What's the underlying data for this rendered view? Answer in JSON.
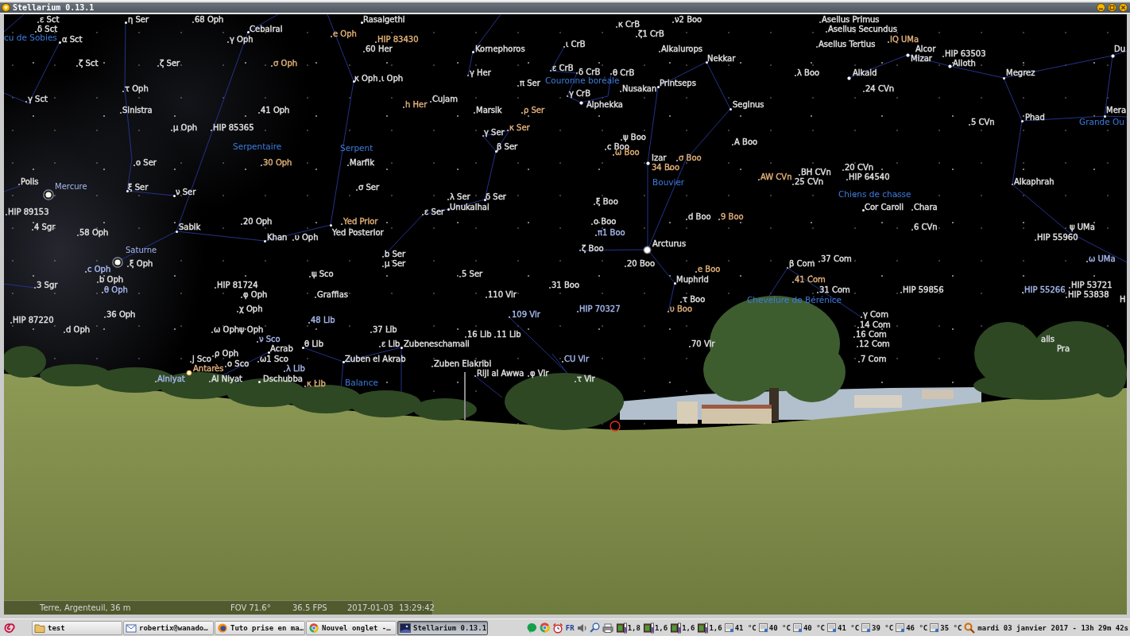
{
  "window": {
    "title": "Stellarium 0.13.1"
  },
  "sky": {
    "constellations": [
      "cu de Sobies",
      "Couronne boréale",
      "Grande Ou",
      "Serpentaire",
      "Serpent",
      "Bouvier",
      "Chiens de chasse",
      "Chevelure de Bérénice",
      "Balance"
    ],
    "planets": [
      "Mercure",
      "Saturne"
    ],
    "stars": [
      {
        "label": "ε Sct",
        "color": "#e0e0e0"
      },
      {
        "label": "η Ser",
        "color": "#e0e0e0"
      },
      {
        "label": "68 Oph",
        "color": "#e0e0e0"
      },
      {
        "label": "Rasalgethi",
        "color": "#e0e0e0"
      },
      {
        "label": "ν2 Boo",
        "color": "#e0e0e0"
      },
      {
        "label": "Asellus Primus",
        "color": "#e0e0e0"
      },
      {
        "label": "κ CrB",
        "color": "#e0e0e0"
      },
      {
        "label": "δ Sct",
        "color": "#e0e0e0"
      },
      {
        "label": "Cebalrai",
        "color": "#e0e0e0"
      },
      {
        "label": "Asellus Secundus",
        "color": "#e0e0e0"
      },
      {
        "label": "e Oph",
        "color": "#e3b178"
      },
      {
        "label": "ζ1 CrB",
        "color": "#e0e0e0"
      },
      {
        "label": "α Sct",
        "color": "#e0e0e0"
      },
      {
        "label": "γ Oph",
        "color": "#e0e0e0"
      },
      {
        "label": "HIP 83430",
        "color": "#e3b178"
      },
      {
        "label": "IQ UMa",
        "color": "#e3b178"
      },
      {
        "label": "ι CrB",
        "color": "#e0e0e0"
      },
      {
        "label": "Asellus Tertius",
        "color": "#e0e0e0"
      },
      {
        "label": "60 Her",
        "color": "#e0e0e0"
      },
      {
        "label": "Kornephoros",
        "color": "#e0e0e0"
      },
      {
        "label": "Alkalurops",
        "color": "#e0e0e0"
      },
      {
        "label": "Alcor",
        "color": "#e0e0e0"
      },
      {
        "label": "Du",
        "color": "#e0e0e0"
      },
      {
        "label": "HIP 63503",
        "color": "#e0e0e0"
      },
      {
        "label": "Nekkar",
        "color": "#e0e0e0"
      },
      {
        "label": "Mizar",
        "color": "#e0e0e0"
      },
      {
        "label": "ζ Sct",
        "color": "#e0e0e0"
      },
      {
        "label": "ζ Ser",
        "color": "#e0e0e0"
      },
      {
        "label": "σ Oph",
        "color": "#e3b178"
      },
      {
        "label": "Alioth",
        "color": "#e0e0e0"
      },
      {
        "label": "ε CrB",
        "color": "#e0e0e0"
      },
      {
        "label": "γ Her",
        "color": "#e0e0e0"
      },
      {
        "label": "δ CrB",
        "color": "#e0e0e0"
      },
      {
        "label": "θ CrB",
        "color": "#e0e0e0"
      },
      {
        "label": "λ Boo",
        "color": "#e0e0e0"
      },
      {
        "label": "Alkaid",
        "color": "#e0e0e0"
      },
      {
        "label": "Megrez",
        "color": "#e0e0e0"
      },
      {
        "label": "κ Oph",
        "color": "#e0e0e0"
      },
      {
        "label": "ι Oph",
        "color": "#e0e0e0"
      },
      {
        "label": "π Ser",
        "color": "#e0e0e0"
      },
      {
        "label": "Printseps",
        "color": "#e0e0e0"
      },
      {
        "label": "τ Oph",
        "color": "#e0e0e0"
      },
      {
        "label": "Nusakan",
        "color": "#e0e0e0"
      },
      {
        "label": "24 CVn",
        "color": "#e0e0e0"
      },
      {
        "label": "γ CrB",
        "color": "#e0e0e0"
      },
      {
        "label": "γ Sct",
        "color": "#e0e0e0"
      },
      {
        "label": "Cujam",
        "color": "#e0e0e0"
      },
      {
        "label": "h Her",
        "color": "#e3b178"
      },
      {
        "label": "Alphekka",
        "color": "#e0e0e0"
      },
      {
        "label": "Seginus",
        "color": "#e0e0e0"
      },
      {
        "label": "Sinistra",
        "color": "#e0e0e0"
      },
      {
        "label": "41 Oph",
        "color": "#e0e0e0"
      },
      {
        "label": "Marsik",
        "color": "#e0e0e0"
      },
      {
        "label": "ρ Ser",
        "color": "#e3b178"
      },
      {
        "label": "Mera",
        "color": "#e0e0e0"
      },
      {
        "label": "Phad",
        "color": "#e0e0e0"
      },
      {
        "label": "5 CVn",
        "color": "#e0e0e0"
      },
      {
        "label": "μ Oph",
        "color": "#e0e0e0"
      },
      {
        "label": "HIP 85365",
        "color": "#e0e0e0"
      },
      {
        "label": "κ Ser",
        "color": "#e3b178"
      },
      {
        "label": "γ Ser",
        "color": "#e0e0e0"
      },
      {
        "label": "ψ Boo",
        "color": "#e0e0e0"
      },
      {
        "label": "A Boo",
        "color": "#e0e0e0"
      },
      {
        "label": "β Ser",
        "color": "#e0e0e0"
      },
      {
        "label": "c Boo",
        "color": "#e0e0e0"
      },
      {
        "label": "ω Boo",
        "color": "#e3b178"
      },
      {
        "label": "Izar",
        "color": "#e0e0e0"
      },
      {
        "label": "σ Boo",
        "color": "#e3b178"
      },
      {
        "label": "ο Ser",
        "color": "#e0e0e0"
      },
      {
        "label": "30 Oph",
        "color": "#e3b178"
      },
      {
        "label": "Marfik",
        "color": "#e0e0e0"
      },
      {
        "label": "34 Boo",
        "color": "#e3b178"
      },
      {
        "label": "20 CVn",
        "color": "#e0e0e0"
      },
      {
        "label": "BH CVn",
        "color": "#e0e0e0"
      },
      {
        "label": "AW CVn",
        "color": "#e3b178"
      },
      {
        "label": "HIP 64540",
        "color": "#e0e0e0"
      },
      {
        "label": "Polis",
        "color": "#e0e0e0"
      },
      {
        "label": "25 CVn",
        "color": "#e0e0e0"
      },
      {
        "label": "Alkaphrah",
        "color": "#e0e0e0"
      },
      {
        "label": "ξ Ser",
        "color": "#e0e0e0"
      },
      {
        "label": "σ Ser",
        "color": "#e0e0e0"
      },
      {
        "label": "ν Ser",
        "color": "#e0e0e0"
      },
      {
        "label": "λ Ser",
        "color": "#e0e0e0"
      },
      {
        "label": "δ Ser",
        "color": "#e0e0e0"
      },
      {
        "label": "ξ Boo",
        "color": "#e0e0e0"
      },
      {
        "label": "Unukalhai",
        "color": "#e0e0e0"
      },
      {
        "label": "Cor Caroli",
        "color": "#e0e0e0"
      },
      {
        "label": "Chara",
        "color": "#e0e0e0"
      },
      {
        "label": "HIP 89153",
        "color": "#e0e0e0"
      },
      {
        "label": "ε Ser",
        "color": "#e0e0e0"
      },
      {
        "label": "d Boo",
        "color": "#e0e0e0"
      },
      {
        "label": "9 Boo",
        "color": "#e3b178"
      },
      {
        "label": "20 Oph",
        "color": "#e0e0e0"
      },
      {
        "label": "Yed Prior",
        "color": "#e3b178"
      },
      {
        "label": "ο Boo",
        "color": "#e0e0e0"
      },
      {
        "label": "4 Sgr",
        "color": "#e0e0e0"
      },
      {
        "label": "Sabik",
        "color": "#e0e0e0"
      },
      {
        "label": "6 CVn",
        "color": "#e0e0e0"
      },
      {
        "label": "ψ UMa",
        "color": "#e0e0e0"
      },
      {
        "label": "58 Oph",
        "color": "#e0e0e0"
      },
      {
        "label": "Yed Posterior",
        "color": "#e0e0e0"
      },
      {
        "label": "π1 Boo",
        "color": "#a6b8ee"
      },
      {
        "label": "Khan",
        "color": "#e0e0e0"
      },
      {
        "label": "υ Oph",
        "color": "#e0e0e0"
      },
      {
        "label": "HIP 55960",
        "color": "#e0e0e0"
      },
      {
        "label": "Arcturus",
        "color": "#e0e0e0"
      },
      {
        "label": "ζ Boo",
        "color": "#e0e0e0"
      },
      {
        "label": "b Ser",
        "color": "#e0e0e0"
      },
      {
        "label": "37 Com",
        "color": "#e0e0e0"
      },
      {
        "label": "ω UMa",
        "color": "#a6b8ee"
      },
      {
        "label": "ξ Oph",
        "color": "#e0e0e0"
      },
      {
        "label": "μ Ser",
        "color": "#e0e0e0"
      },
      {
        "label": "20 Boo",
        "color": "#e0e0e0"
      },
      {
        "label": "β Com",
        "color": "#e0e0e0"
      },
      {
        "label": "c Oph",
        "color": "#a6b8ee"
      },
      {
        "label": "e Boo",
        "color": "#e3b178"
      },
      {
        "label": "ψ Sco",
        "color": "#e0e0e0"
      },
      {
        "label": "5 Ser",
        "color": "#e0e0e0"
      },
      {
        "label": "b Oph",
        "color": "#e0e0e0"
      },
      {
        "label": "Muphrid",
        "color": "#e0e0e0"
      },
      {
        "label": "41 Com",
        "color": "#e3b178"
      },
      {
        "label": "3 Sgr",
        "color": "#e0e0e0"
      },
      {
        "label": "HIP 81724",
        "color": "#e0e0e0"
      },
      {
        "label": "31 Boo",
        "color": "#e0e0e0"
      },
      {
        "label": "HIP 53721",
        "color": "#e0e0e0"
      },
      {
        "label": "θ Oph",
        "color": "#a6b8ee"
      },
      {
        "label": "31 Com",
        "color": "#e0e0e0"
      },
      {
        "label": "HIP 59856",
        "color": "#e0e0e0"
      },
      {
        "label": "HIP 55266",
        "color": "#a6b8ee"
      },
      {
        "label": "φ Oph",
        "color": "#e0e0e0"
      },
      {
        "label": "Graffias",
        "color": "#e0e0e0"
      },
      {
        "label": "110 Vir",
        "color": "#e0e0e0"
      },
      {
        "label": "HIP 53838",
        "color": "#e0e0e0"
      },
      {
        "label": "τ Boo",
        "color": "#e0e0e0"
      },
      {
        "label": "H",
        "color": "#e0e0e0"
      },
      {
        "label": "χ Oph",
        "color": "#e0e0e0"
      },
      {
        "label": "HIP 70327",
        "color": "#a6b8ee"
      },
      {
        "label": "υ Boo",
        "color": "#e3b178"
      },
      {
        "label": "36 Oph",
        "color": "#e0e0e0"
      },
      {
        "label": "109 Vir",
        "color": "#a6b8ee"
      },
      {
        "label": "γ Com",
        "color": "#e0e0e0"
      },
      {
        "label": "HIP 87220",
        "color": "#e0e0e0"
      },
      {
        "label": "48 Lib",
        "color": "#a6b8ee"
      },
      {
        "label": "14 Com",
        "color": "#e0e0e0"
      },
      {
        "label": "d Oph",
        "color": "#e0e0e0"
      },
      {
        "label": "ω Oph",
        "color": "#e0e0e0"
      },
      {
        "label": "ψ Oph",
        "color": "#e0e0e0"
      },
      {
        "label": "37 Lib",
        "color": "#e0e0e0"
      },
      {
        "label": "16 Lib",
        "color": "#e0e0e0"
      },
      {
        "label": "11 Lib",
        "color": "#e0e0e0"
      },
      {
        "label": "16 Com",
        "color": "#e0e0e0"
      },
      {
        "label": "ν Sco",
        "color": "#a6b8ee"
      },
      {
        "label": "alis",
        "color": "#e0e0e0"
      },
      {
        "label": "θ Lib",
        "color": "#e0e0e0"
      },
      {
        "label": "ε Lib",
        "color": "#e0e0e0"
      },
      {
        "label": "Zubeneschamali",
        "color": "#e0e0e0"
      },
      {
        "label": "70 Vir",
        "color": "#e0e0e0"
      },
      {
        "label": "12 Com",
        "color": "#e0e0e0"
      },
      {
        "label": "Acrab",
        "color": "#e0e0e0"
      },
      {
        "label": "Pra",
        "color": "#e0e0e0"
      },
      {
        "label": "ρ Oph",
        "color": "#e0e0e0"
      },
      {
        "label": "j Sco",
        "color": "#e0e0e0"
      },
      {
        "label": "ω1 Sco",
        "color": "#e0e0e0"
      },
      {
        "label": "Zuben el Akrab",
        "color": "#e0e0e0"
      },
      {
        "label": "CU Vir",
        "color": "#a6b8ee"
      },
      {
        "label": "7 Com",
        "color": "#e0e0e0"
      },
      {
        "label": "ο Sco",
        "color": "#e0e0e0"
      },
      {
        "label": "Zuben Elakribi",
        "color": "#e0e0e0"
      },
      {
        "label": "Antarès",
        "color": "#e3b178"
      },
      {
        "label": "λ Lib",
        "color": "#a6b8ee"
      },
      {
        "label": "Rijl al Awwa",
        "color": "#e0e0e0"
      },
      {
        "label": "φ Vir",
        "color": "#e0e0e0"
      },
      {
        "label": "Alniyat",
        "color": "#a6b8ee"
      },
      {
        "label": "Al Niyat",
        "color": "#e0e0e0"
      },
      {
        "label": "Dschubba",
        "color": "#e0e0e0"
      },
      {
        "label": "τ Vir",
        "color": "#e0e0e0"
      },
      {
        "label": "κ Lib",
        "color": "#e3b178"
      }
    ]
  },
  "status_bar": {
    "location": "Terre, Argenteuil, 36 m",
    "fov": "FOV 71.6°",
    "fps": "36.5 FPS",
    "date": "2017-01-03",
    "time": "13:29:42"
  },
  "taskbar": {
    "tasks": [
      {
        "kind": "folder",
        "label": "test",
        "selected": false
      },
      {
        "kind": "mail",
        "label": "robertix@wanado…",
        "selected": false
      },
      {
        "kind": "firefox",
        "label": "Tuto prise en ma…",
        "selected": false
      },
      {
        "kind": "chrome",
        "label": "Nouvel onglet -…",
        "selected": false
      },
      {
        "kind": "stellarium",
        "label": "Stellarium 0.13.1",
        "selected": true
      }
    ],
    "tray": {
      "keyboard_layout": "FR",
      "cpu_meters": [
        "1,8",
        "1,6",
        "1,6",
        "1,6"
      ],
      "temperatures": [
        "41 °C",
        "40 °C",
        "40 °C",
        "41 °C",
        "39 °C",
        "46 °C",
        "35 °C"
      ],
      "clock": "mardi 03 janvier 2017 - 13h 29m 42s"
    }
  }
}
